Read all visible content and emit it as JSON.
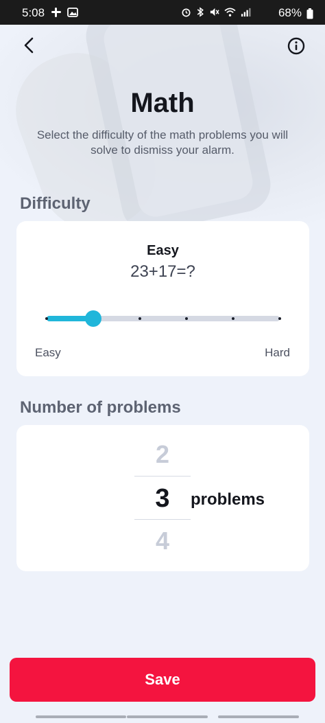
{
  "status_bar": {
    "time": "5:08",
    "battery_percent": "68%",
    "left_icons": [
      "slack-icon",
      "image-icon"
    ],
    "right_icons": [
      "alarm-icon",
      "bluetooth-icon",
      "mute-icon",
      "wifi-icon",
      "signal-icon",
      "battery-icon"
    ]
  },
  "header": {
    "back_icon": "chevron-left-icon",
    "info_icon": "info-icon",
    "title": "Math",
    "subtitle": "Select the difficulty of the math problems you will solve to dismiss your alarm."
  },
  "difficulty": {
    "section_label": "Difficulty",
    "level_name": "Easy",
    "example": "23+17=?",
    "min_label": "Easy",
    "max_label": "Hard",
    "step_count": 6,
    "selected_step": 1,
    "accent_color": "#20b6da"
  },
  "problems": {
    "section_label": "Number of problems",
    "prev_value": "2",
    "current_value": "3",
    "next_value": "4",
    "unit_label": "problems"
  },
  "footer": {
    "save_label": "Save",
    "save_color": "#f4143f"
  }
}
